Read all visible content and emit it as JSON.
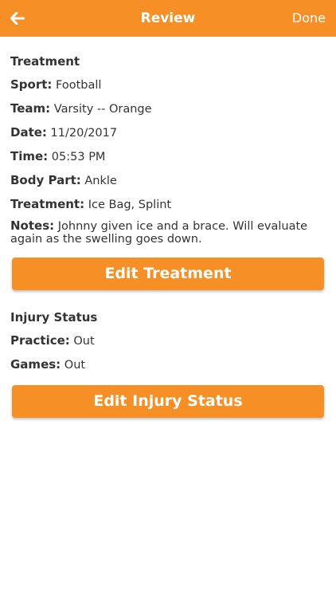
{
  "header": {
    "title": "Review",
    "done_label": "Done",
    "back_icon": "arrow-left-icon"
  },
  "colors": {
    "accent": "#F58F26",
    "text": "#333333"
  },
  "treatment": {
    "section_title": "Treatment",
    "sport_label": "Sport:",
    "sport": "Football",
    "team_label": "Team:",
    "team": "Varsity -- Orange",
    "date_label": "Date:",
    "date": "11/20/2017",
    "time_label": "Time:",
    "time": "05:53 PM",
    "body_part_label": "Body Part:",
    "body_part": "Ankle",
    "treatment_label": "Treatment:",
    "treatment": "Ice Bag, Splint",
    "notes_label": "Notes:",
    "notes": "Johnny given ice and a brace. Will evaluate again as the swelling goes down.",
    "edit_button": "Edit Treatment"
  },
  "injury_status": {
    "section_title": "Injury Status",
    "practice_label": "Practice:",
    "practice": "Out",
    "games_label": "Games:",
    "games": "Out",
    "edit_button": "Edit Injury Status"
  }
}
